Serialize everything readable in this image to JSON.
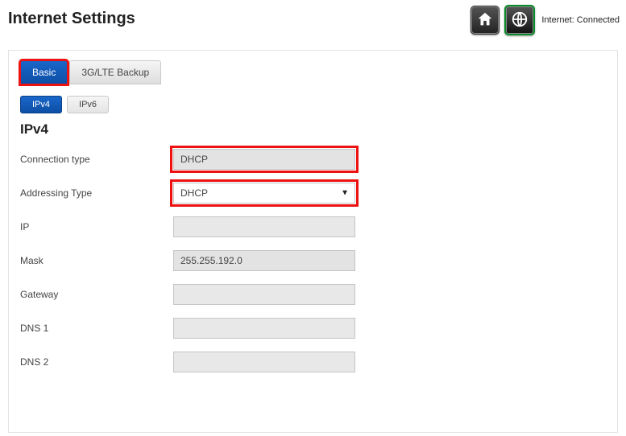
{
  "header": {
    "title": "Internet Settings",
    "status_label": "Internet: Connected"
  },
  "tabs": {
    "basic": "Basic",
    "backup": "3G/LTE Backup"
  },
  "subtabs": {
    "ipv4": "IPv4",
    "ipv6": "IPv6"
  },
  "section": {
    "title": "IPv4"
  },
  "form": {
    "connection_type": {
      "label": "Connection type",
      "value": "DHCP"
    },
    "addressing_type": {
      "label": "Addressing Type",
      "value": "DHCP"
    },
    "ip": {
      "label": "IP",
      "value": ""
    },
    "mask": {
      "label": "Mask",
      "value": "255.255.192.0"
    },
    "gateway": {
      "label": "Gateway",
      "value": ""
    },
    "dns1": {
      "label": "DNS 1",
      "value": ""
    },
    "dns2": {
      "label": "DNS 2",
      "value": ""
    }
  },
  "colors": {
    "accent": "#0d4fa5",
    "highlight": "#e11"
  }
}
